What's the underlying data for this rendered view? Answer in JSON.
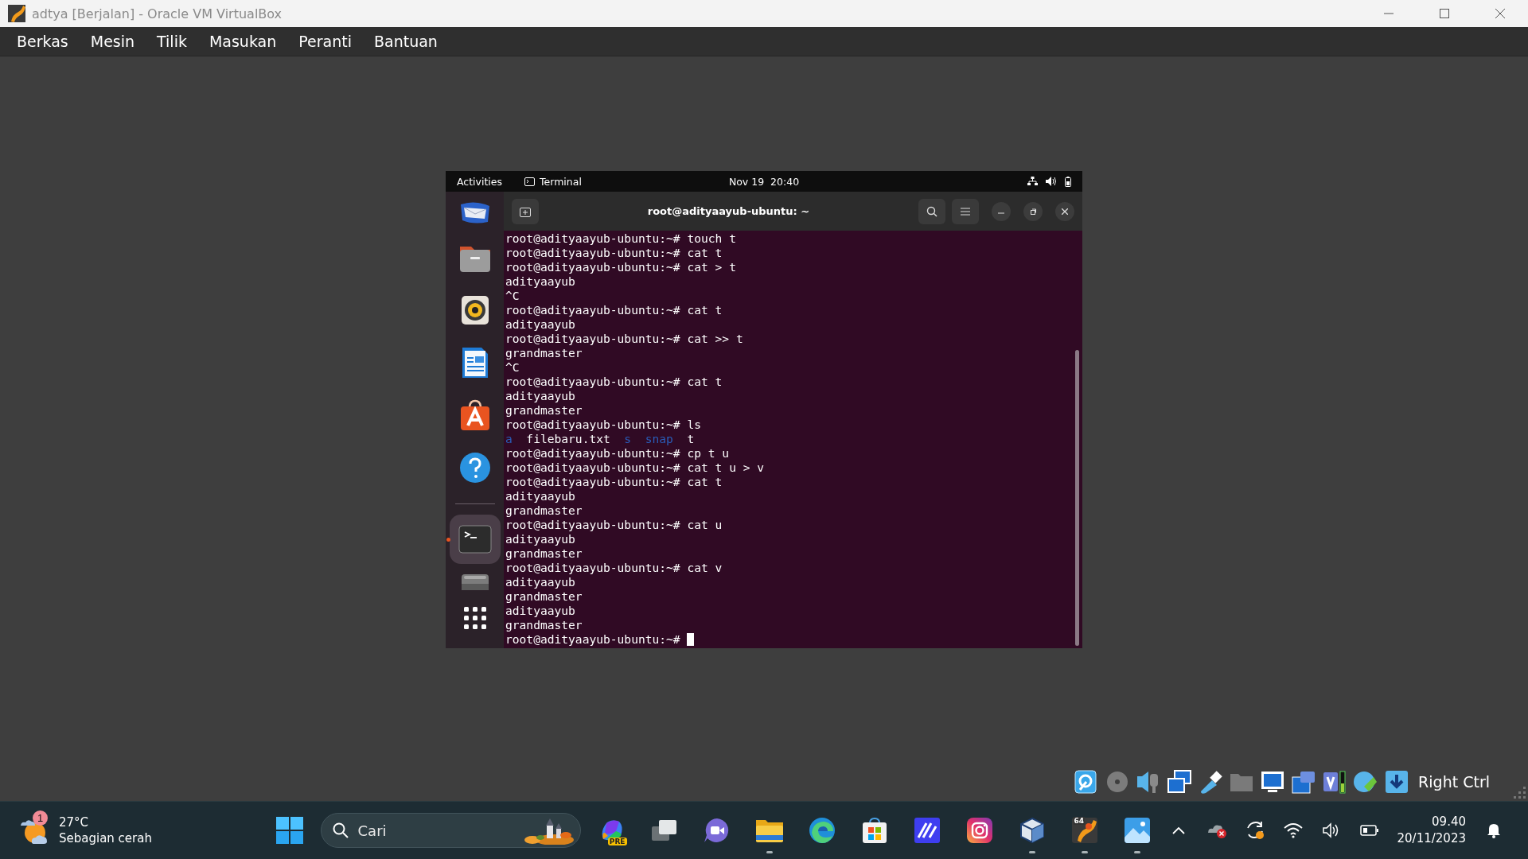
{
  "window": {
    "title": "adtya [Berjalan] - Oracle VM VirtualBox"
  },
  "menu": [
    "Berkas",
    "Mesin",
    "Tilik",
    "Masukan",
    "Peranti",
    "Bantuan"
  ],
  "guest": {
    "top_bar": {
      "activities": "Activities",
      "app": "Terminal",
      "clock": "Nov 19  20:40"
    },
    "dock": {
      "items": [
        {
          "selected": false,
          "running": false
        },
        {
          "selected": false,
          "running": false
        },
        {
          "selected": false,
          "running": false
        },
        {
          "selected": false,
          "running": false
        },
        {
          "selected": false,
          "running": false
        },
        {
          "selected": false,
          "running": false
        },
        {
          "selected": true,
          "running": true
        },
        {
          "selected": false,
          "running": false
        },
        {
          "selected": false,
          "running": false
        }
      ]
    },
    "terminal": {
      "title": "root@adityaayub-ubuntu: ~",
      "cursor": true,
      "lines": [
        {
          "kind": "text",
          "text": "root@adityaayub-ubuntu:~# touch t"
        },
        {
          "kind": "text",
          "text": "root@adityaayub-ubuntu:~# cat t"
        },
        {
          "kind": "text",
          "text": "root@adityaayub-ubuntu:~# cat > t"
        },
        {
          "kind": "text",
          "text": "adityaayub"
        },
        {
          "kind": "text",
          "text": "^C"
        },
        {
          "kind": "text",
          "text": "root@adityaayub-ubuntu:~# cat t"
        },
        {
          "kind": "text",
          "text": "adityaayub"
        },
        {
          "kind": "text",
          "text": "root@adityaayub-ubuntu:~# cat >> t"
        },
        {
          "kind": "text",
          "text": "grandmaster"
        },
        {
          "kind": "text",
          "text": "^C"
        },
        {
          "kind": "text",
          "text": "root@adityaayub-ubuntu:~# cat t"
        },
        {
          "kind": "text",
          "text": "adityaayub"
        },
        {
          "kind": "text",
          "text": "grandmaster"
        },
        {
          "kind": "text",
          "text": "root@adityaayub-ubuntu:~# ls"
        },
        {
          "kind": "listing",
          "items": [
            {
              "text": "a",
              "color": "#2a5cb8"
            },
            {
              "text": "filebaru.txt",
              "color": "#ffffff"
            },
            {
              "text": "s",
              "color": "#2a5cb8"
            },
            {
              "text": "snap",
              "color": "#2a5cb8"
            },
            {
              "text": "t",
              "color": "#ffffff"
            }
          ]
        },
        {
          "kind": "text",
          "text": "root@adityaayub-ubuntu:~# cp t u"
        },
        {
          "kind": "text",
          "text": "root@adityaayub-ubuntu:~# cat t u > v"
        },
        {
          "kind": "text",
          "text": "root@adityaayub-ubuntu:~# cat t"
        },
        {
          "kind": "text",
          "text": "adityaayub"
        },
        {
          "kind": "text",
          "text": "grandmaster"
        },
        {
          "kind": "text",
          "text": "root@adityaayub-ubuntu:~# cat u"
        },
        {
          "kind": "text",
          "text": "adityaayub"
        },
        {
          "kind": "text",
          "text": "grandmaster"
        },
        {
          "kind": "text",
          "text": "root@adityaayub-ubuntu:~# cat v"
        },
        {
          "kind": "text",
          "text": "adityaayub"
        },
        {
          "kind": "text",
          "text": "grandmaster"
        },
        {
          "kind": "text",
          "text": "adityaayub"
        },
        {
          "kind": "text",
          "text": "grandmaster"
        },
        {
          "kind": "text",
          "text": "root@adityaayub-ubuntu:~#"
        }
      ]
    }
  },
  "vm_status": {
    "host_key": "Right Ctrl"
  },
  "taskbar": {
    "weather": {
      "temperature": "27°C",
      "condition": "Sebagian cerah",
      "badge": "1"
    },
    "search": {
      "placeholder": "Cari"
    },
    "apps": [
      {
        "badge": "PRE",
        "running": false
      },
      {
        "running": false
      },
      {
        "running": false
      },
      {
        "running": true
      },
      {
        "running": false
      },
      {
        "running": false
      },
      {
        "running": false
      },
      {
        "running": false
      },
      {
        "running": true
      },
      {
        "badge": "64",
        "running": true
      },
      {
        "running": true
      }
    ],
    "clock": {
      "time": "09.40",
      "date": "20/11/2023"
    }
  }
}
